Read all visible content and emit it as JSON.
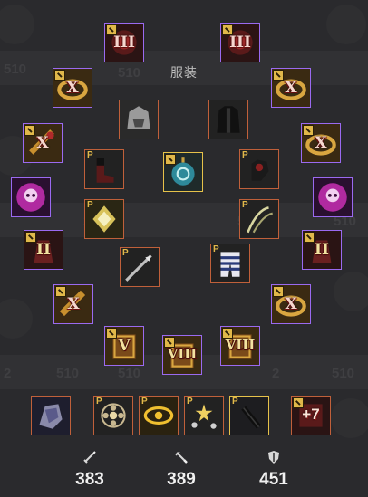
{
  "panel": {
    "title": "服装"
  },
  "background": {
    "ghost_text": [
      "510",
      "510",
      "2",
      "510",
      "510",
      "2",
      "510",
      "510",
      "2",
      "510"
    ]
  },
  "slots": {
    "earring_left": {
      "label": "III",
      "icon": "earring-icon"
    },
    "earring_right": {
      "label": "III",
      "icon": "earring-icon"
    },
    "ring_left_top": {
      "label": "X",
      "icon": "ring-icon"
    },
    "ring_right_top": {
      "label": "X",
      "icon": "ring-icon"
    },
    "costume_helmet": {
      "icon": "beast-helmet-icon"
    },
    "costume_armor": {
      "icon": "dark-coat-icon"
    },
    "bracelet_left": {
      "label": "X",
      "icon": "bracelet-icon"
    },
    "bracelet_right": {
      "label": "X",
      "icon": "ring-icon"
    },
    "costume_boots": {
      "badge": "P",
      "icon": "boots-icon"
    },
    "amulet": {
      "icon": "amulet-icon"
    },
    "costume_gloves": {
      "badge": "P",
      "icon": "gloves-icon"
    },
    "orb_left": {
      "icon": "skull-orb-icon"
    },
    "orb_right": {
      "icon": "skull-orb-icon"
    },
    "costume_brooch": {
      "badge": "P",
      "icon": "gold-brooch-icon"
    },
    "costume_whip": {
      "badge": "P",
      "icon": "whip-icon"
    },
    "gauntlet_left": {
      "label": "II",
      "icon": "gauntlet-icon"
    },
    "gauntlet_right": {
      "label": "II",
      "icon": "gauntlet-icon"
    },
    "costume_weapon": {
      "badge": "P",
      "icon": "spear-icon"
    },
    "costume_pants": {
      "badge": "P",
      "icon": "striped-pants-icon"
    },
    "belt_left": {
      "label": "X",
      "icon": "belt-icon"
    },
    "belt_right": {
      "label": "X",
      "icon": "ring-icon"
    },
    "book_v": {
      "label": "V",
      "icon": "book-icon"
    },
    "book_viii_a": {
      "label": "VIII",
      "icon": "book-icon"
    },
    "book_viii_b": {
      "label": "VIII",
      "icon": "book-icon"
    }
  },
  "bottom_row": [
    {
      "icon": "crystal-gauntlet-icon",
      "badge": ""
    },
    {
      "icon": "flower-icon",
      "badge": "P"
    },
    {
      "icon": "golden-eye-icon",
      "badge": "P"
    },
    {
      "icon": "stars-icon",
      "badge": "P"
    },
    {
      "icon": "dark-blade-icon",
      "badge": "P"
    },
    {
      "icon": "enhance-scroll-icon",
      "label": "+7"
    }
  ],
  "stats": [
    {
      "icon": "sword-icon",
      "value": "383"
    },
    {
      "icon": "dagger-icon",
      "value": "389"
    },
    {
      "icon": "shield-icon",
      "value": "451"
    }
  ]
}
